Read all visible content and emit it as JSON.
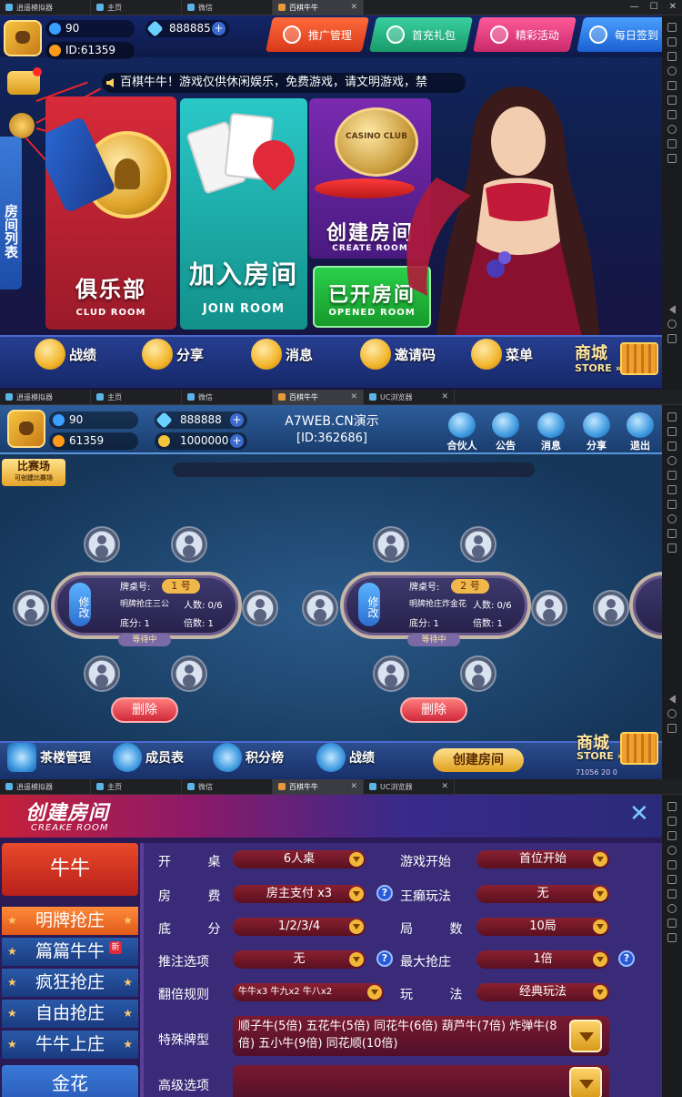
{
  "browser_tabs": [
    {
      "label": "逍遥模拟器"
    },
    {
      "label": "主页"
    },
    {
      "label": "微信"
    },
    {
      "label": "百棋牛牛"
    },
    {
      "label": "UC浏览器"
    }
  ],
  "screen1": {
    "player": {
      "beans": "90",
      "id": "ID:61359",
      "diamonds": "888885"
    },
    "top_buttons": [
      {
        "label": "推广管理"
      },
      {
        "label": "首充礼包"
      },
      {
        "label": "精彩活动"
      },
      {
        "label": "每日签到"
      }
    ],
    "marquee": "百棋牛牛！游戏仅供休闲娱乐，免费游戏，请文明游戏，禁",
    "side_tab": "房间列表",
    "cards": {
      "club": {
        "cn": "俱乐部",
        "en": "CLUD ROOM"
      },
      "join": {
        "cn": "加入房间",
        "en": "JOIN ROOM"
      },
      "create": {
        "cn": "创建房间",
        "en": "CREATE ROOM",
        "chip": "CASINO CLUB"
      },
      "opened": {
        "cn": "已开房间",
        "en": "OPENED ROOM"
      }
    },
    "bottom": [
      {
        "label": "战绩"
      },
      {
        "label": "分享"
      },
      {
        "label": "消息"
      },
      {
        "label": "邀请码"
      },
      {
        "label": "菜单"
      }
    ],
    "store_cn": "商城",
    "store_en": "STORE"
  },
  "screen2": {
    "player": {
      "beans": "90",
      "id": "61359",
      "diamonds": "888888",
      "gold": "1000000"
    },
    "center_title": "A7WEB.CN演示",
    "center_id": "[ID:362686]",
    "header_buttons": [
      {
        "label": "合伙人"
      },
      {
        "label": "公告"
      },
      {
        "label": "消息"
      },
      {
        "label": "分享"
      },
      {
        "label": "退出"
      }
    ],
    "compete_tag": "比赛场",
    "compete_sub": "可创建比赛场",
    "tables": [
      {
        "modify": "修改",
        "table_no_label": "牌桌号:",
        "table_no": "1 号",
        "mode": "明牌抢庄三公",
        "players": "人数: 0/6",
        "base": "底分: 1",
        "multiple": "倍数: 1",
        "status": "等待中",
        "delete": "删除"
      },
      {
        "modify": "修改",
        "table_no_label": "牌桌号:",
        "table_no": "2 号",
        "mode": "明牌抢庄炸金花",
        "players": "人数: 0/6",
        "base": "底分: 1",
        "multiple": "倍数: 1",
        "status": "等待中",
        "delete": "删除"
      }
    ],
    "bottom": [
      {
        "label": "茶楼管理"
      },
      {
        "label": "成员表"
      },
      {
        "label": "积分榜"
      },
      {
        "label": "战绩"
      }
    ],
    "create_btn": "创建房间",
    "store_cn": "商城",
    "store_en": "STORE",
    "store_meta": "71056 20 0"
  },
  "screen3": {
    "title": "创建房间",
    "subtitle": "CREAKE ROOM",
    "close": "✕",
    "nav": [
      {
        "label": "牛牛"
      },
      {
        "label": "明牌抢庄"
      },
      {
        "label": "篇篇牛牛"
      },
      {
        "label": "疯狂抢庄"
      },
      {
        "label": "自由抢庄"
      },
      {
        "label": "牛牛上庄"
      },
      {
        "label": "金花"
      }
    ],
    "new_badge": "新",
    "form": {
      "open_label": "开 桌",
      "open_value": "6人桌",
      "start_label": "游戏开始",
      "start_value": "首位开始",
      "fee_label": "房 费",
      "fee_value": "房主支付 x3",
      "laizi_label": "王癞玩法",
      "laizi_value": "无",
      "base_label": "底 分",
      "base_value": "1/2/3/4",
      "rounds_label": "局 数",
      "rounds_value": "10局",
      "push_label": "推注选项",
      "push_value": "无",
      "maxbid_label": "最大抢庄",
      "maxbid_value": "1倍",
      "double_label": "翻倍规则",
      "double_value": "牛牛x3 牛九x2 牛八x2",
      "mode_label": "玩 法",
      "mode_value": "经典玩法",
      "special_label": "特殊牌型",
      "special_value": "顺子牛(5倍) 五花牛(5倍) 同花牛(6倍) 葫芦牛(7倍) 炸弹牛(8倍) 五小牛(9倍) 同花顺(10倍)",
      "advanced_label": "高级选项",
      "help": "?"
    }
  }
}
